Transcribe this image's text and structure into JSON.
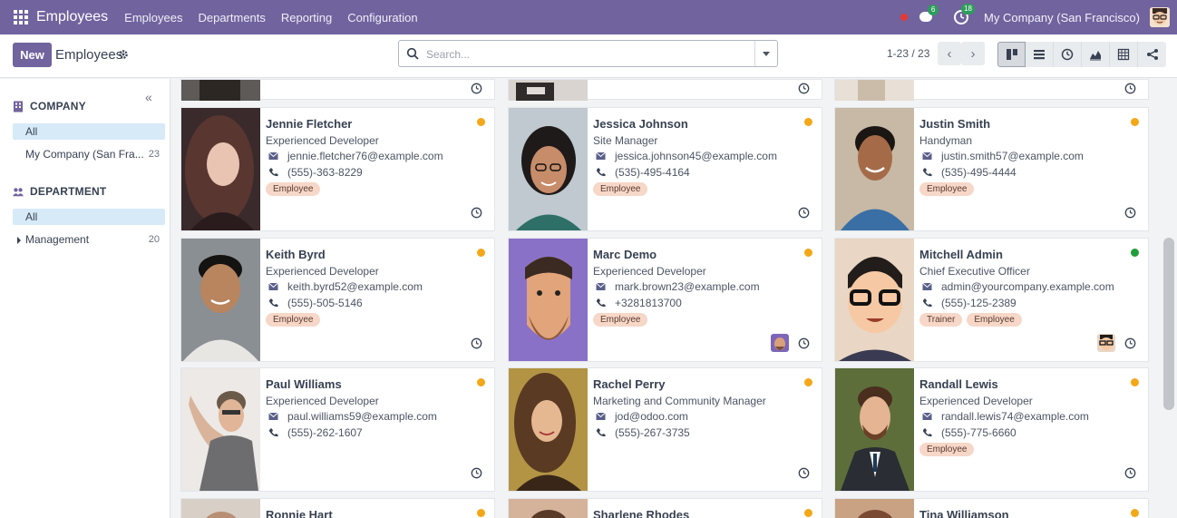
{
  "navbar": {
    "app_name": "Employees",
    "menu": [
      "Employees",
      "Departments",
      "Reporting",
      "Configuration"
    ],
    "messages_count": "6",
    "activities_count": "18",
    "company": "My Company (San Francisco)"
  },
  "control_panel": {
    "new_label": "New",
    "title": "Employees",
    "search_placeholder": "Search...",
    "pager": "1-23 / 23"
  },
  "side_panel": {
    "company_heading": "COMPANY",
    "company_items": [
      {
        "label": "All",
        "count": ""
      },
      {
        "label": "My Company (San Fra...",
        "count": "23"
      }
    ],
    "department_heading": "DEPARTMENT",
    "department_items": [
      {
        "label": "All",
        "count": ""
      },
      {
        "label": "Management",
        "count": "20"
      }
    ]
  },
  "employees": [
    {
      "name": "Jennie Fletcher",
      "job": "Experienced Developer",
      "email": "jennie.fletcher76@example.com",
      "phone": "(555)-363-8229",
      "tags": [
        "Employee"
      ],
      "status_color": "#f4a818"
    },
    {
      "name": "Jessica Johnson",
      "job": "Site Manager",
      "email": "jessica.johnson45@example.com",
      "phone": "(535)-495-4164",
      "tags": [
        "Employee"
      ],
      "status_color": "#f4a818"
    },
    {
      "name": "Justin Smith",
      "job": "Handyman",
      "email": "justin.smith57@example.com",
      "phone": "(535)-495-4444",
      "tags": [
        "Employee"
      ],
      "status_color": "#f4a818"
    },
    {
      "name": "Keith Byrd",
      "job": "Experienced Developer",
      "email": "keith.byrd52@example.com",
      "phone": "(555)-505-5146",
      "tags": [
        "Employee"
      ],
      "status_color": "#f4a818"
    },
    {
      "name": "Marc Demo",
      "job": "Experienced Developer",
      "email": "mark.brown23@example.com",
      "phone": "+3281813700",
      "tags": [
        "Employee"
      ],
      "status_color": "#f4a818"
    },
    {
      "name": "Mitchell Admin",
      "job": "Chief Executive Officer",
      "email": "admin@yourcompany.example.com",
      "phone": "(555)-125-2389",
      "tags": [
        "Trainer",
        "Employee"
      ],
      "status_color": "#1f9d3a"
    },
    {
      "name": "Paul Williams",
      "job": "Experienced Developer",
      "email": "paul.williams59@example.com",
      "phone": "(555)-262-1607",
      "tags": [],
      "status_color": "#f4a818"
    },
    {
      "name": "Rachel Perry",
      "job": "Marketing and Community Manager",
      "email": "jod@odoo.com",
      "phone": "(555)-267-3735",
      "tags": [],
      "status_color": "#f4a818"
    },
    {
      "name": "Randall Lewis",
      "job": "Experienced Developer",
      "email": "randall.lewis74@example.com",
      "phone": "(555)-775-6660",
      "tags": [
        "Employee"
      ],
      "status_color": "#f4a818"
    },
    {
      "name": "Ronnie Hart",
      "status_color": "#f4a818"
    },
    {
      "name": "Sharlene Rhodes",
      "status_color": "#f4a818"
    },
    {
      "name": "Tina Williamson",
      "status_color": "#f4a818"
    }
  ]
}
